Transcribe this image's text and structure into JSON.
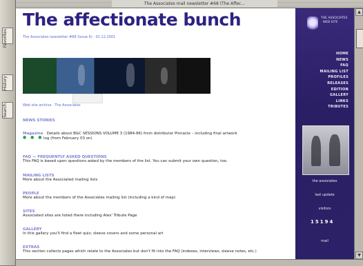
{
  "window": {
    "title": "The Associates mail newsletter #68 (The Affec..."
  },
  "left_sidebar": {
    "labels": [
      "Favorites",
      "History",
      "Search"
    ]
  },
  "page": {
    "site_title": "The affectionate bunch",
    "subtitle": "The Associates newsletter #68 (Issue 6) · 01.12.2001",
    "under_banner_link": "Web site archive · The Associates",
    "sections": [
      {
        "head": "NEWS STORIES",
        "text": ""
      },
      {
        "head": "Magazine",
        "text": "Details about B&C SESSIONS VOLUME 3 (1984-86) from distributor Pinnacle – including final artwork"
      },
      {
        "head": "",
        "text": "log (from February 03 on)"
      },
      {
        "head": "FAQ — FREQUENTLY ASKED QUESTIONS",
        "text": "This FAQ is based upon questions asked by the members of the list. You can submit your own question, too."
      },
      {
        "head": "MAILING LISTS",
        "text": "More about the Associated mailing lists"
      },
      {
        "head": "PEOPLE",
        "text": "More about the members of the Associates mailing list (including a kind of map)"
      },
      {
        "head": "SITES",
        "text": "Associated sites are listed there including Alex' Tribute Page"
      },
      {
        "head": "GALLERY",
        "text": "In this gallery you'll find a fleet quiz, sleeve covers and some personal art"
      },
      {
        "head": "EXTRAS",
        "text": "This section collects pages which relate to the Associates but don't fit into the FAQ (indexes, interviews, sleeve notes, etc.)"
      }
    ],
    "dots": "● ● ●"
  },
  "right_panel": {
    "logo_text": "THE ASSOCIATES · WEB SITE",
    "nav": [
      "HOME",
      "NEWS",
      "FAQ",
      "MAILING LIST",
      "PROFILES",
      "RELEASES",
      "EDITION",
      "GALLERY",
      "LINKS",
      "TRIBUTES"
    ],
    "photo_caption": "the associates",
    "last_update": "last update",
    "counter_label": "visitors",
    "counter": "15194",
    "mail": "mail"
  }
}
